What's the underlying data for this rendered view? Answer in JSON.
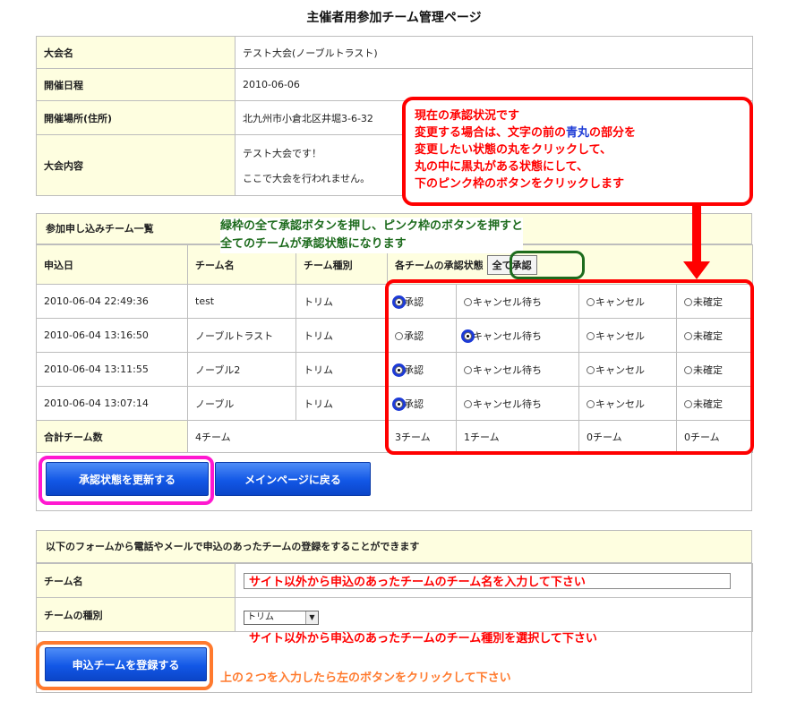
{
  "page_title": "主催者用参加チーム管理ページ",
  "info": {
    "rows": [
      {
        "label": "大会名",
        "value": "テスト大会(ノーブルトラスト)"
      },
      {
        "label": "開催日程",
        "value": "2010-06-06"
      },
      {
        "label": "開催場所(住所)",
        "value": "北九州市小倉北区井堀3-6-32"
      }
    ],
    "content_label": "大会内容",
    "content_lines": [
      "テスト大会です！",
      "ここで大会を行われません。"
    ]
  },
  "teams": {
    "section_title": "参加申し込みチーム一覧",
    "headers": {
      "date": "申込日",
      "name": "チーム名",
      "type": "チーム種別",
      "status": "各チームの承認状態"
    },
    "approve_all_label": "全て承認",
    "status_options": [
      "承認",
      "キャンセル待ち",
      "キャンセル",
      "未確定"
    ],
    "rows": [
      {
        "date": "2010-06-04 22:49:36",
        "name": "test",
        "type": "トリム",
        "selected": "承認"
      },
      {
        "date": "2010-06-04 13:16:50",
        "name": "ノーブルトラスト",
        "type": "トリム",
        "selected": "キャンセル待ち"
      },
      {
        "date": "2010-06-04 13:11:55",
        "name": "ノーブル2",
        "type": "トリム",
        "selected": "承認"
      },
      {
        "date": "2010-06-04 13:07:14",
        "name": "ノーブル",
        "type": "トリム",
        "selected": "承認"
      }
    ],
    "total_label": "合計チーム数",
    "total_count": "4チーム",
    "totals": [
      "3チーム",
      "1チーム",
      "0チーム",
      "0チーム"
    ]
  },
  "buttons": {
    "update": "承認状態を更新する",
    "back": "メインページに戻る",
    "register": "申込チームを登録する"
  },
  "register": {
    "section_title": "以下のフォームから電話やメールで申込のあったチームの登録をすることができます",
    "name_label": "チーム名",
    "type_label": "チームの種別",
    "type_selected": "トリム"
  },
  "annotations": {
    "box_lines": [
      "現在の承認状況です",
      "変更する場合は、文字の前の",
      "青丸",
      "の部分を",
      "変更したい状態の丸をクリックして、",
      "丸の中に黒丸がある状態にして、",
      "下のピンク枠のボタンをクリックします"
    ],
    "green_lines": [
      "緑枠の全て承認ボタンを押し、ピンク枠のボタンを押すと",
      "全てのチームが承認状態になります"
    ],
    "hint_name": "サイト以外から申込のあったチームのチーム名を入力して下さい",
    "hint_type": "サイト以外から申込のあったチームのチーム種別を選択して下さい",
    "hint_register": "上の２つを入力したら左のボタンをクリックして下さい"
  },
  "colors": {
    "annotation_red": "#ff0000",
    "annotation_green": "#1d6b1d",
    "annotation_magenta": "#ff18d0",
    "annotation_orange": "#ff7a2e",
    "radio_highlight": "#1d3bd6"
  }
}
